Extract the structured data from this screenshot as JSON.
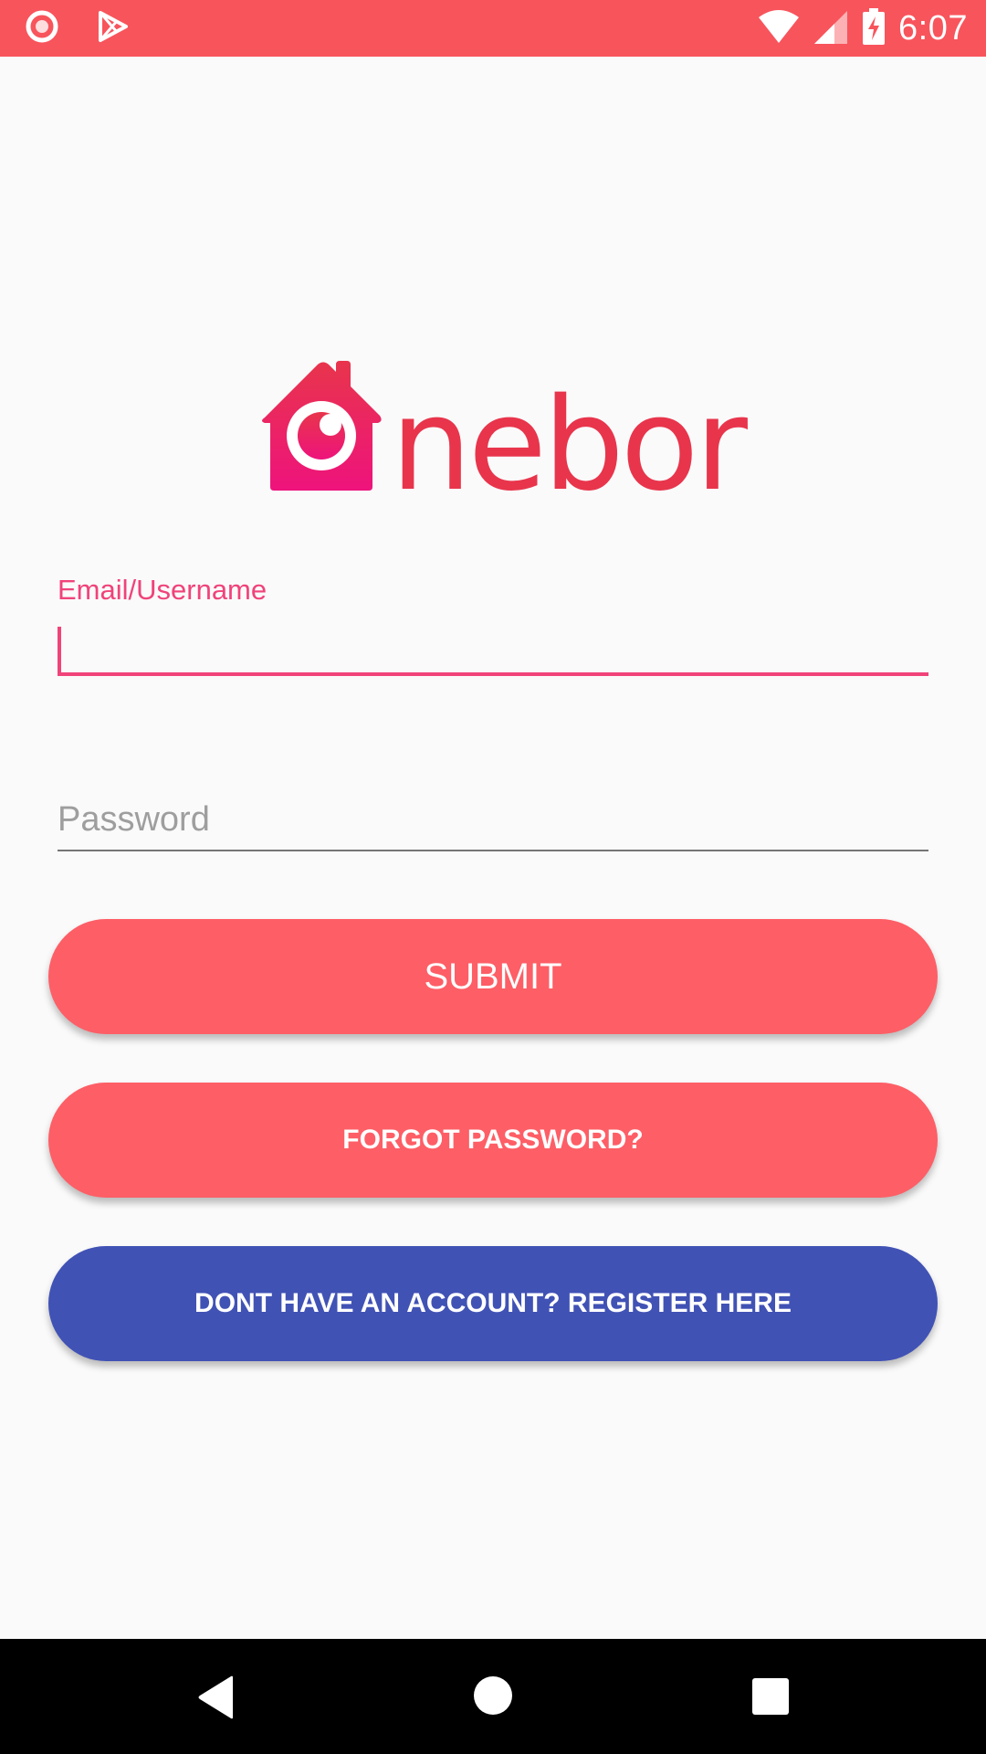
{
  "status_bar": {
    "time": "6:07",
    "icons": [
      "record-icon",
      "play-store-icon",
      "wifi-icon",
      "signal-icon",
      "battery-charging-icon"
    ],
    "color": "#f8545c"
  },
  "logo": {
    "text": "nebor",
    "icon": "house-eye-logo-icon",
    "color": "#e8354c"
  },
  "form": {
    "email_label": "Email/Username",
    "email_value": "",
    "password_placeholder": "Password",
    "password_value": ""
  },
  "buttons": {
    "submit": "SUBMIT",
    "forgot": "FORGOT PASSWORD?",
    "register": "DONT HAVE AN ACCOUNT? REGISTER HERE"
  },
  "colors": {
    "accent": "#f0437a",
    "primary_button": "#fe5e66",
    "secondary_button": "#4152b5"
  },
  "nav_bar": {
    "icons": [
      "back-icon",
      "home-icon",
      "recents-icon"
    ]
  }
}
